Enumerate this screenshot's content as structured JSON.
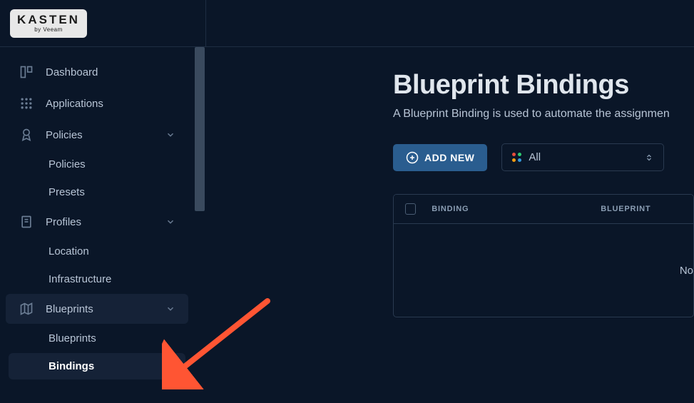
{
  "logo": {
    "text": "KASTEN",
    "subtext": "by Veeam"
  },
  "sidebar": {
    "dashboard": "Dashboard",
    "applications": "Applications",
    "policies": {
      "label": "Policies",
      "policies": "Policies",
      "presets": "Presets"
    },
    "profiles": {
      "label": "Profiles",
      "location": "Location",
      "infrastructure": "Infrastructure"
    },
    "blueprints": {
      "label": "Blueprints",
      "blueprints": "Blueprints",
      "bindings": "Bindings"
    }
  },
  "main": {
    "title": "Blueprint Bindings",
    "description": "A Blueprint Binding is used to automate the assignmen",
    "add_button_label": "ADD NEW",
    "filter": {
      "label": "All"
    },
    "table": {
      "col_binding": "BINDING",
      "col_blueprint": "BLUEPRINT",
      "no_data": "No"
    }
  }
}
